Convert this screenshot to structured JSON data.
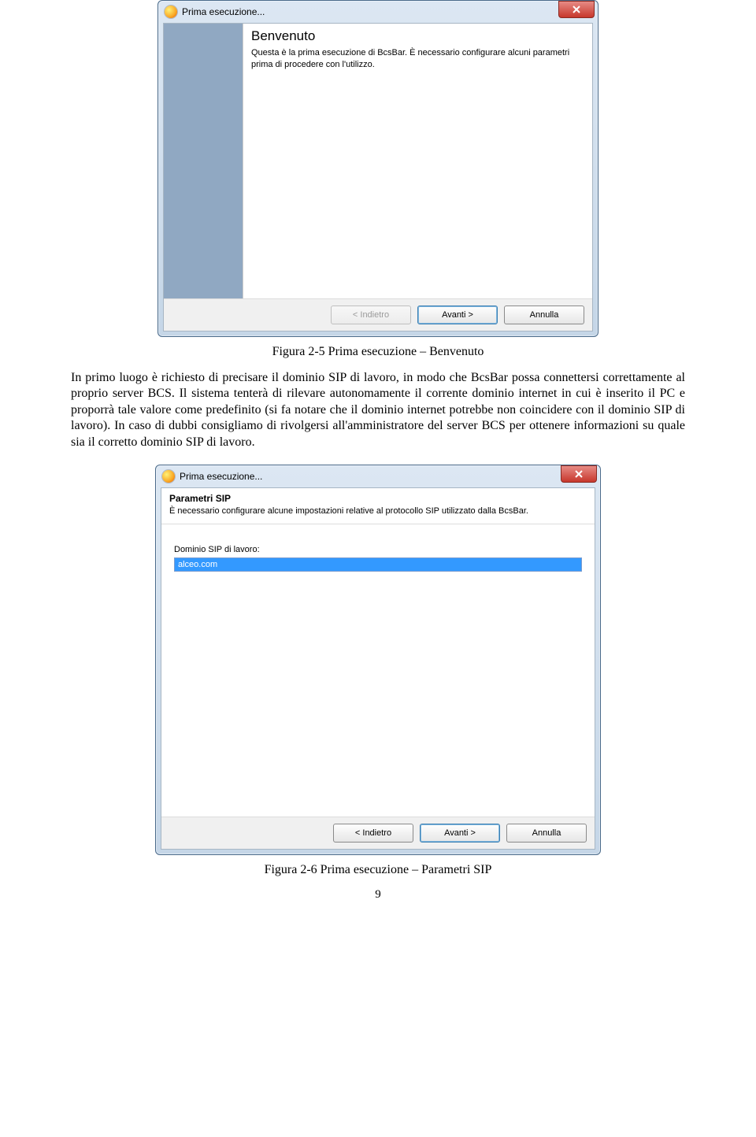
{
  "dialog1": {
    "title": "Prima esecuzione...",
    "welcome_heading": "Benvenuto",
    "welcome_body": "Questa è la prima esecuzione di BcsBar. È necessario configurare alcuni parametri prima di procedere con l'utilizzo.",
    "buttons": {
      "back": "< Indietro",
      "next": "Avanti >",
      "cancel": "Annulla"
    }
  },
  "caption1": "Figura 2-5 Prima esecuzione – Benvenuto",
  "paragraph": "In primo luogo è richiesto di precisare il dominio SIP di lavoro, in modo che BcsBar possa connettersi correttamente al proprio server BCS. Il sistema tenterà di rilevare autonomamente il corrente dominio internet in cui è inserito il PC e proporrà tale valore come predefinito (si fa notare che il dominio internet potrebbe non coincidere con il dominio SIP di lavoro). In caso di dubbi consigliamo di rivolgersi all'amministratore del server BCS per ottenere informazioni su quale sia il corretto dominio SIP di lavoro.",
  "dialog2": {
    "title": "Prima esecuzione...",
    "header_title": "Parametri SIP",
    "header_desc": "È necessario configurare alcune impostazioni relative al protocollo SIP utilizzato dalla BcsBar.",
    "field_label": "Dominio SIP di lavoro:",
    "field_value": "alceo.com",
    "buttons": {
      "back": "< Indietro",
      "next": "Avanti >",
      "cancel": "Annulla"
    }
  },
  "caption2": "Figura 2-6 Prima esecuzione – Parametri SIP",
  "page_number": "9"
}
